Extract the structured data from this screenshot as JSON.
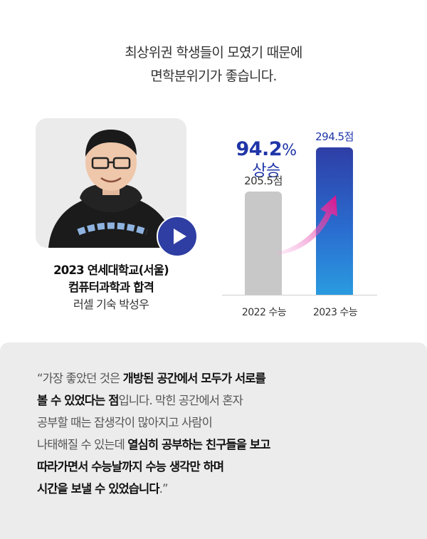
{
  "headline": {
    "line1": "최상위권 학생들이 모였기 때문에",
    "line2": "면학분위기가 좋습니다."
  },
  "profile": {
    "line1": "2023 연세대학교(서울)",
    "line2": "컴퓨터과학과 합격",
    "line3": "러셀 기숙 박성우"
  },
  "rise": {
    "value": "94.2",
    "unit": "%",
    "word": "상승"
  },
  "chart_data": {
    "type": "bar",
    "categories": [
      "2022 수능",
      "2023 수능"
    ],
    "values": [
      205.5,
      294.5
    ],
    "value_labels": [
      "205.5점",
      "294.5점"
    ],
    "ylim": [
      0,
      310
    ],
    "colors": [
      "#c8c8c8",
      "#2e3ea6"
    ]
  },
  "quote": [
    [
      {
        "t": "“가장 좋았던 것은 ",
        "b": false
      },
      {
        "t": "개방된 공간에서 모두가 서로를",
        "b": true
      }
    ],
    [
      {
        "t": "볼 수 있었다는 점",
        "b": true
      },
      {
        "t": "입니다. 막힌 공간에서 혼자",
        "b": false
      }
    ],
    [
      {
        "t": "공부할 때는 잡생각이 많아지고 사람이",
        "b": false
      }
    ],
    [
      {
        "t": "나태해질 수 있는데 ",
        "b": false
      },
      {
        "t": "열심히 공부하는 친구들을 보고",
        "b": true
      }
    ],
    [
      {
        "t": "따라가면서 수능날까지 수능 생각만 하며",
        "b": true
      }
    ],
    [
      {
        "t": "시간을 보낼 수 있었습니다",
        "b": true
      },
      {
        "t": ".”",
        "b": false
      }
    ]
  ]
}
